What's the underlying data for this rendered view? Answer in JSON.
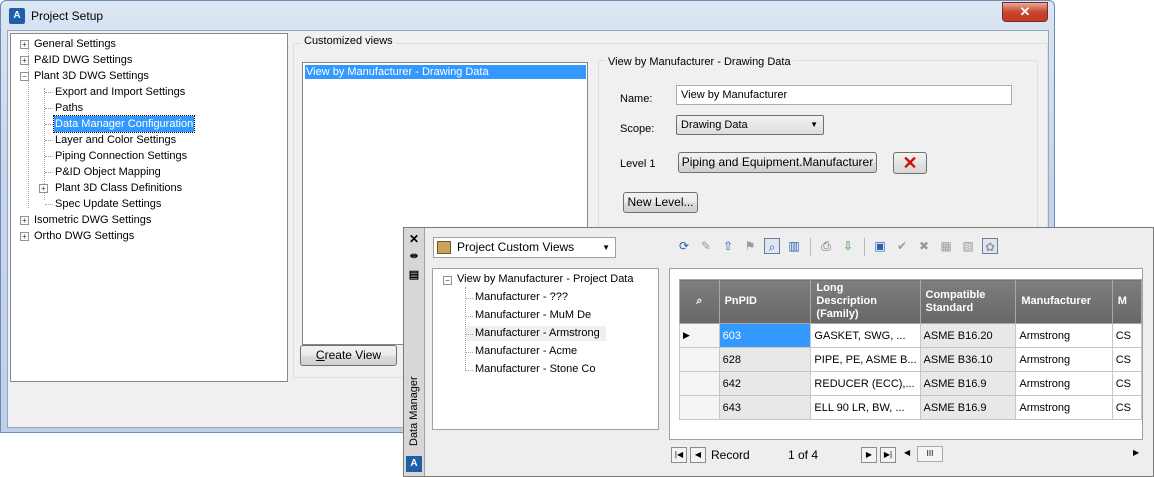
{
  "window": {
    "title": "Project Setup",
    "close": "✕"
  },
  "tree": [
    {
      "label": "General Settings",
      "expander": "+"
    },
    {
      "label": "P&ID DWG Settings",
      "expander": "+"
    },
    {
      "label": "Plant 3D DWG Settings",
      "expander": "−"
    },
    {
      "label": "Export and Import Settings"
    },
    {
      "label": "Paths"
    },
    {
      "label": "Data Manager Configuration",
      "selected": true
    },
    {
      "label": "Layer and Color Settings"
    },
    {
      "label": "Piping Connection Settings"
    },
    {
      "label": "P&ID Object Mapping"
    },
    {
      "label": "Plant 3D Class Definitions",
      "expander": "+"
    },
    {
      "label": "Spec Update Settings"
    },
    {
      "label": "Isometric DWG Settings",
      "expander": "+"
    },
    {
      "label": "Ortho DWG Settings",
      "expander": "+"
    }
  ],
  "customized_views": {
    "group_label": "Customized views",
    "items": [
      "View by Manufacturer - Drawing Data"
    ],
    "create_button": "Create View",
    "create_accel": "C"
  },
  "detail": {
    "title": "View by Manufacturer - Drawing Data",
    "name_label": "Name:",
    "name_value": "View by Manufacturer",
    "scope_label": "Scope:",
    "scope_value": "Drawing Data",
    "level_label": "Level 1",
    "level_button": "Piping and Equipment.Manufacturer",
    "remove_icon": "✕",
    "new_level_button": "New Level..."
  },
  "data_manager": {
    "vertical_label": "Data Manager",
    "view_combo": "Project Custom Views",
    "tree": {
      "root": "View by Manufacturer - Project Data",
      "children": [
        "Manufacturer - ???",
        "Manufacturer - MuM De",
        "Manufacturer - Armstrong",
        "Manufacturer - Acme",
        "Manufacturer - Stone Co"
      ]
    },
    "grid": {
      "columns": [
        "PnPID",
        "Long\nDescription\n(Family)",
        "Compatible\nStandard",
        "Manufacturer",
        "M"
      ],
      "rows": [
        {
          "pnpid": "603",
          "desc": "GASKET, SWG, ...",
          "std": "ASME B16.20",
          "mfr": "Armstrong",
          "m": "CS"
        },
        {
          "pnpid": "628",
          "desc": "PIPE, PE, ASME B...",
          "std": "ASME B36.10",
          "mfr": "Armstrong",
          "m": "CS"
        },
        {
          "pnpid": "642",
          "desc": "REDUCER (ECC),...",
          "std": "ASME B16.9",
          "mfr": "Armstrong",
          "m": "CS"
        },
        {
          "pnpid": "643",
          "desc": "ELL 90 LR, BW, ...",
          "std": "ASME B16.9",
          "mfr": "Armstrong",
          "m": "CS"
        }
      ]
    },
    "nav": {
      "record_label": "Record",
      "position": "1 of 4",
      "scroll_mark": "III"
    }
  }
}
